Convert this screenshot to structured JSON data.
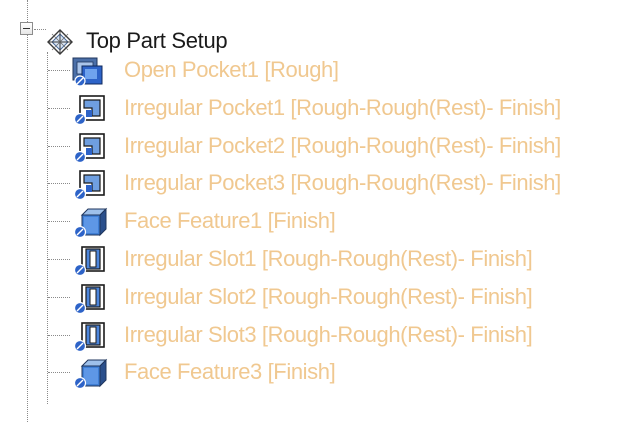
{
  "root": {
    "label": "Top Part Setup",
    "icon": "setup-icon",
    "expanded": true
  },
  "items": [
    {
      "label": "Open Pocket1 [Rough]",
      "icon": "open-pocket-icon"
    },
    {
      "label": "Irregular Pocket1 [Rough-Rough(Rest)- Finish]",
      "icon": "irregular-pocket-icon"
    },
    {
      "label": "Irregular Pocket2 [Rough-Rough(Rest)- Finish]",
      "icon": "irregular-pocket-icon"
    },
    {
      "label": "Irregular Pocket3 [Rough-Rough(Rest)- Finish]",
      "icon": "irregular-pocket-icon"
    },
    {
      "label": "Face Feature1 [Finish]",
      "icon": "face-feature-icon"
    },
    {
      "label": "Irregular Slot1 [Rough-Rough(Rest)- Finish]",
      "icon": "irregular-slot-icon"
    },
    {
      "label": "Irregular Slot2 [Rough-Rough(Rest)- Finish]",
      "icon": "irregular-slot-icon"
    },
    {
      "label": "Irregular Slot3 [Rough-Rough(Rest)- Finish]",
      "icon": "irregular-slot-icon"
    },
    {
      "label": "Face Feature3 [Finish]",
      "icon": "face-feature-icon"
    }
  ],
  "colors": {
    "item_text": "#f0c890",
    "root_text": "#1a1a1a",
    "connector": "#8a8a8a"
  }
}
